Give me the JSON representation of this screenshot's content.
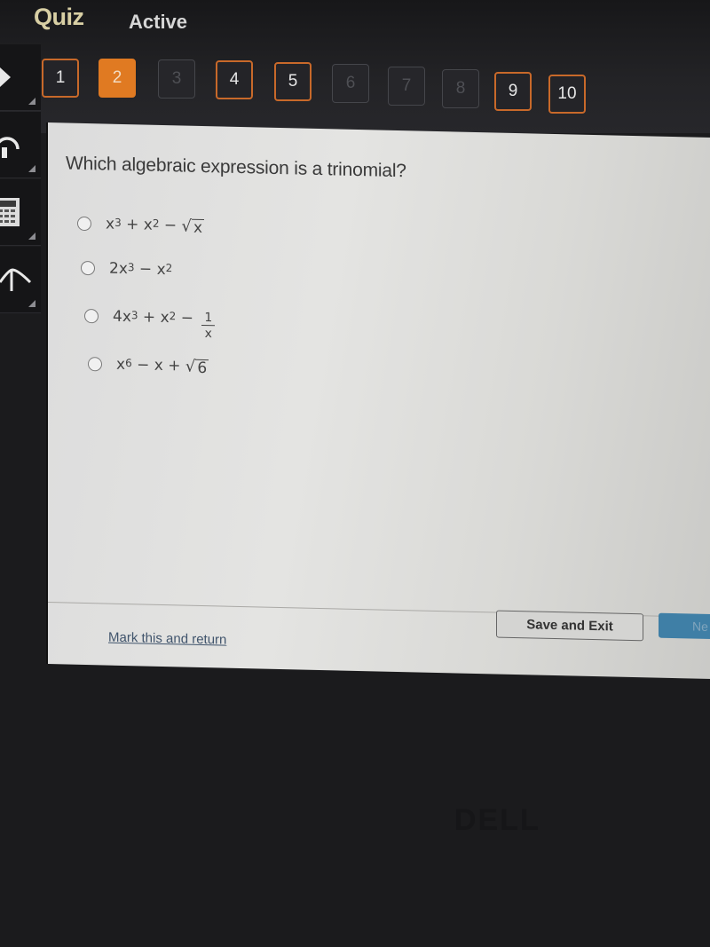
{
  "header": {
    "title": "Quiz",
    "status": "Active"
  },
  "question_nav": [
    {
      "label": "1",
      "state": "answered"
    },
    {
      "label": "2",
      "state": "current"
    },
    {
      "label": "3",
      "state": "unanswered"
    },
    {
      "label": "4",
      "state": "answered"
    },
    {
      "label": "5",
      "state": "answered"
    },
    {
      "label": "6",
      "state": "unanswered"
    },
    {
      "label": "7",
      "state": "unanswered"
    },
    {
      "label": "8",
      "state": "unanswered"
    },
    {
      "label": "9",
      "state": "answered"
    },
    {
      "label": "10",
      "state": "answered"
    }
  ],
  "sidebar": {
    "tools": [
      {
        "name": "pointer-icon"
      },
      {
        "name": "headphones-icon"
      },
      {
        "name": "calculator-icon"
      },
      {
        "name": "formula-reference-icon"
      }
    ]
  },
  "question": {
    "text": "Which algebraic expression is a trinomial?",
    "options": [
      {
        "text": "x³ + x² − √x",
        "parts": {
          "a": "x",
          "a_exp": "3",
          "op1": " + ",
          "b": "x",
          "b_exp": "2",
          "op2": " − ",
          "radicand": "x"
        }
      },
      {
        "text": "2x³ − x²",
        "parts": {
          "a": "2x",
          "a_exp": "3",
          "op1": " − ",
          "b": "x",
          "b_exp": "2"
        }
      },
      {
        "text": "4x³ + x² − 1/x",
        "parts": {
          "a": "4x",
          "a_exp": "3",
          "op1": " + ",
          "b": "x",
          "b_exp": "2",
          "op2": " − ",
          "num": "1",
          "den": "x"
        }
      },
      {
        "text": "x⁶ − x + √6",
        "parts": {
          "a": "x",
          "a_exp": "6",
          "op1": " − ",
          "b": "x",
          "op2": " + ",
          "radicand": "6"
        }
      }
    ],
    "selected": null
  },
  "footer": {
    "mark_link": "Mark this and return",
    "save_exit": "Save and Exit",
    "next": "Next",
    "next_visible": "Ne"
  },
  "colors": {
    "accent_orange": "#e07a22",
    "answered_border": "#c8692a",
    "next_blue": "#3f7fa6",
    "link": "#40546c"
  },
  "bezel": {
    "logo": "DELL"
  }
}
